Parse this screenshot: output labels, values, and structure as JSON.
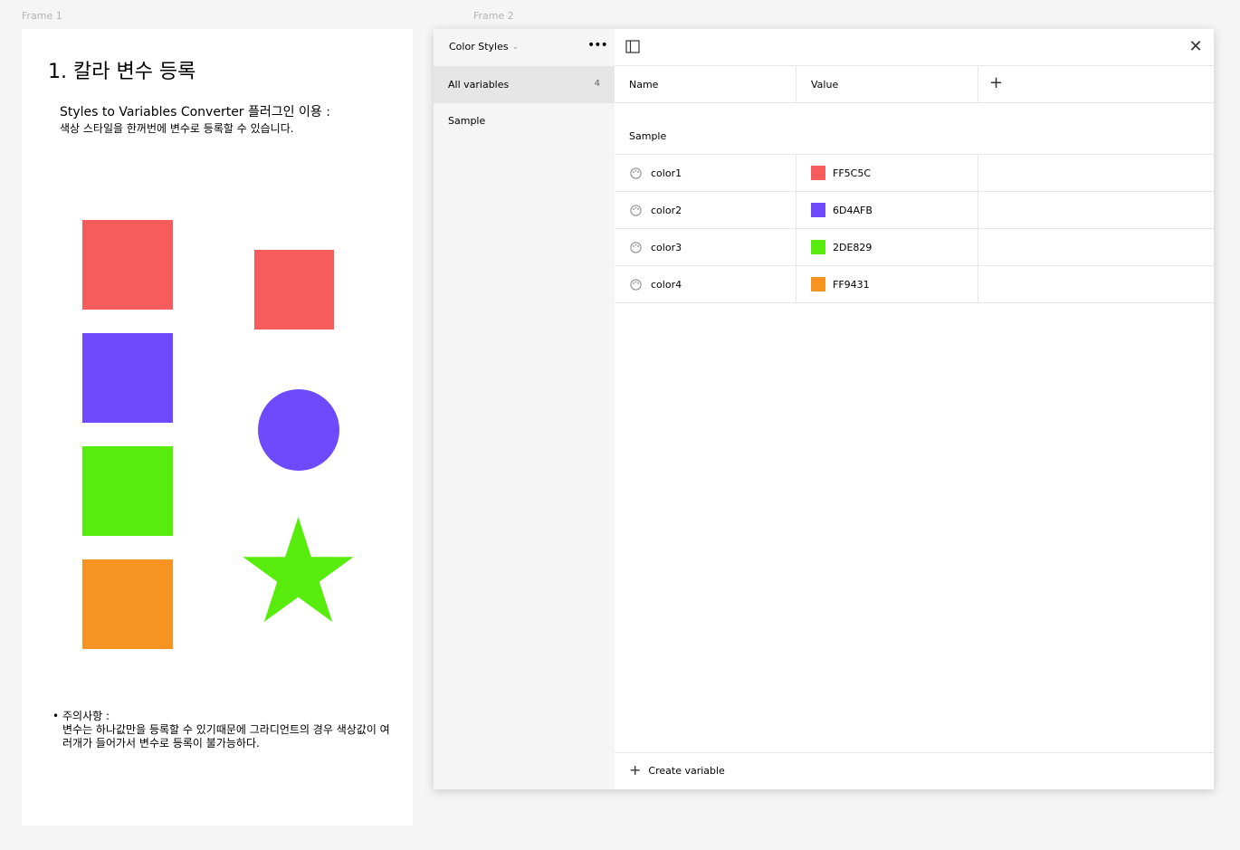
{
  "canvas": {
    "frame1_label": "Frame 1",
    "frame2_label": "Frame 2"
  },
  "frame1": {
    "title": "1. 칼라 변수 등록",
    "subtitle": "Styles to Variables Converter 플러그인 이용 :",
    "description": "색상 스타일을 한꺼번에 변수로 등록할 수 있습니다.",
    "note_bullet": "•",
    "note_title": "주의사항 :",
    "note_body": "변수는 하나값만을 등록할 수 있기때문에 그라디언트의 경우 색상값이 여러개가 들어가서 변수로 등록이 불가능하다.",
    "colors": {
      "red": "#F75C5C",
      "purple": "#6D4AFB",
      "green": "#57EC0C",
      "orange": "#F79421"
    }
  },
  "panel": {
    "collection_name": "Color Styles",
    "collection_chevron": "chevron-down-icon",
    "more_icon": "more-icon",
    "sidebar": [
      {
        "label": "All variables",
        "count": "4",
        "active": true
      },
      {
        "label": "Sample",
        "count": "",
        "active": false
      }
    ],
    "columns": {
      "name": "Name",
      "value": "Value"
    },
    "group": "Sample",
    "variables": [
      {
        "name": "color1",
        "value": "FF5C5C",
        "color": "#F75C5C"
      },
      {
        "name": "color2",
        "value": "6D4AFB",
        "color": "#6D4AFB"
      },
      {
        "name": "color3",
        "value": "2DE829",
        "color": "#57EC0C"
      },
      {
        "name": "color4",
        "value": "FF9431",
        "color": "#F79421"
      }
    ],
    "create_label": "Create variable"
  }
}
